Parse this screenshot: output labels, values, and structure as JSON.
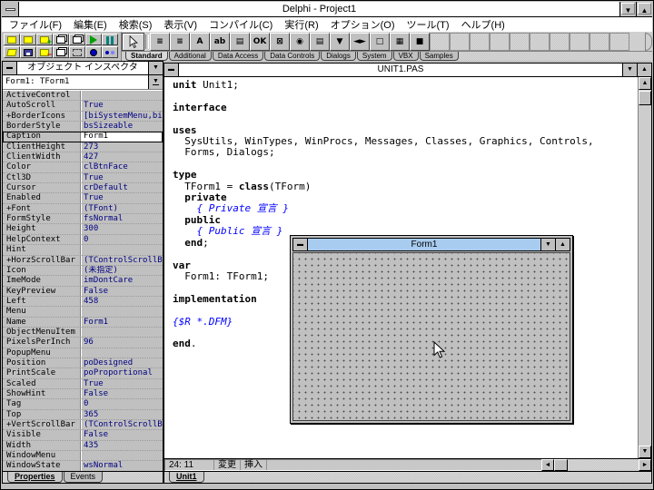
{
  "window": {
    "title": "Delphi - Project1",
    "menus": [
      "ファイル(F)",
      "編集(E)",
      "検索(S)",
      "表示(V)",
      "コンパイル(C)",
      "実行(R)",
      "オプション(O)",
      "ツール(T)",
      "ヘルプ(H)"
    ]
  },
  "toolbar": {
    "speed_buttons_row1": [
      {
        "name": "open-project-button",
        "icon": "folder",
        "badge": "",
        "badge_color": ""
      },
      {
        "name": "save-project-button",
        "icon": "folder",
        "badge": "",
        "badge_color": ""
      },
      {
        "name": "add-file-button",
        "icon": "folder",
        "badge": "+",
        "badge_color": "#00a000"
      },
      {
        "name": "view-unit-button",
        "icon": "pages",
        "badge": "",
        "badge_color": ""
      },
      {
        "name": "view-form-button",
        "icon": "pages",
        "badge": "",
        "badge_color": ""
      },
      {
        "name": "run-button",
        "icon": "run",
        "badge": "",
        "badge_color": ""
      },
      {
        "name": "pause-button",
        "icon": "pause",
        "badge": "",
        "badge_color": ""
      }
    ],
    "speed_buttons_row2": [
      {
        "name": "open-file-button",
        "icon": "folder-open",
        "badge": "",
        "badge_color": ""
      },
      {
        "name": "save-file-button",
        "icon": "floppy",
        "badge": "",
        "badge_color": ""
      },
      {
        "name": "remove-file-button",
        "icon": "folder",
        "badge": "−",
        "badge_color": "#d00000"
      },
      {
        "name": "new-form-button",
        "icon": "pages",
        "badge": "",
        "badge_color": ""
      },
      {
        "name": "toggle-form-unit-button",
        "icon": "select",
        "badge": "",
        "badge_color": ""
      },
      {
        "name": "trace-into-button",
        "icon": "debug",
        "badge": "",
        "badge_color": ""
      },
      {
        "name": "step-over-button",
        "icon": "debug2",
        "badge": "",
        "badge_color": ""
      }
    ],
    "components": [
      {
        "name": "component-mainmenu",
        "glyph": "≡"
      },
      {
        "name": "component-popupmenu",
        "glyph": "≡"
      },
      {
        "name": "component-label",
        "glyph": "A"
      },
      {
        "name": "component-edit",
        "glyph": "ab"
      },
      {
        "name": "component-memo",
        "glyph": "▤"
      },
      {
        "name": "component-button",
        "glyph": "OK"
      },
      {
        "name": "component-checkbox",
        "glyph": "⊠"
      },
      {
        "name": "component-radiobutton",
        "glyph": "◉"
      },
      {
        "name": "component-listbox",
        "glyph": "▤"
      },
      {
        "name": "component-combobox",
        "glyph": "▼"
      },
      {
        "name": "component-scrollbar",
        "glyph": "◄►"
      },
      {
        "name": "component-groupbox",
        "glyph": "□"
      },
      {
        "name": "component-radiogroup",
        "glyph": "▦"
      },
      {
        "name": "component-panel",
        "glyph": "■"
      }
    ],
    "empty_cells": 10,
    "palette_tabs": [
      "Standard",
      "Additional",
      "Data Access",
      "Data Controls",
      "Dialogs",
      "System",
      "VBX",
      "Samples"
    ]
  },
  "inspector": {
    "title": "オブジェクト インスペクタ",
    "selected_object": "Form1: TForm1",
    "tabs": [
      "Properties",
      "Events"
    ],
    "properties": [
      {
        "n": "ActiveControl",
        "v": ""
      },
      {
        "n": "AutoScroll",
        "v": "True"
      },
      {
        "n": "+BorderIcons",
        "v": "[biSystemMenu,biMi"
      },
      {
        "n": "BorderStyle",
        "v": "bsSizeable"
      },
      {
        "n": "Caption",
        "v": "Form1",
        "edit": true
      },
      {
        "n": "ClientHeight",
        "v": "273"
      },
      {
        "n": "ClientWidth",
        "v": "427"
      },
      {
        "n": "Color",
        "v": "clBtnFace"
      },
      {
        "n": "Ctl3D",
        "v": "True"
      },
      {
        "n": "Cursor",
        "v": "crDefault"
      },
      {
        "n": "Enabled",
        "v": "True"
      },
      {
        "n": "+Font",
        "v": "(TFont)"
      },
      {
        "n": "FormStyle",
        "v": "fsNormal"
      },
      {
        "n": "Height",
        "v": "300"
      },
      {
        "n": "HelpContext",
        "v": "0"
      },
      {
        "n": "Hint",
        "v": ""
      },
      {
        "n": "+HorzScrollBar",
        "v": "(TControlScrollBar"
      },
      {
        "n": "Icon",
        "v": "(未指定)"
      },
      {
        "n": "ImeMode",
        "v": "imDontCare"
      },
      {
        "n": "KeyPreview",
        "v": "False"
      },
      {
        "n": "Left",
        "v": "458"
      },
      {
        "n": "Menu",
        "v": ""
      },
      {
        "n": "Name",
        "v": "Form1"
      },
      {
        "n": "ObjectMenuItem",
        "v": ""
      },
      {
        "n": "PixelsPerInch",
        "v": "96"
      },
      {
        "n": "PopupMenu",
        "v": ""
      },
      {
        "n": "Position",
        "v": "poDesigned"
      },
      {
        "n": "PrintScale",
        "v": "poProportional"
      },
      {
        "n": "Scaled",
        "v": "True"
      },
      {
        "n": "ShowHint",
        "v": "False"
      },
      {
        "n": "Tag",
        "v": "0"
      },
      {
        "n": "Top",
        "v": "365"
      },
      {
        "n": "+VertScrollBar",
        "v": "(TControlScrollBar"
      },
      {
        "n": "Visible",
        "v": "False"
      },
      {
        "n": "Width",
        "v": "435"
      },
      {
        "n": "WindowMenu",
        "v": ""
      },
      {
        "n": "WindowState",
        "v": "wsNormal"
      }
    ]
  },
  "editor": {
    "title": "UNIT1.PAS",
    "tab": "Unit1",
    "status": {
      "line_col": " 24:  11",
      "modified": "変更",
      "mode": "挿入"
    },
    "code": [
      [
        [
          "k",
          "unit"
        ],
        [
          "p",
          " Unit1;"
        ]
      ],
      [],
      [
        [
          "k",
          "interface"
        ]
      ],
      [],
      [
        [
          "k",
          "uses"
        ]
      ],
      [
        [
          "p",
          "  SysUtils, WinTypes, WinProcs, Messages, Classes, Graphics, Controls,"
        ]
      ],
      [
        [
          "p",
          "  Forms, Dialogs;"
        ]
      ],
      [],
      [
        [
          "k",
          "type"
        ]
      ],
      [
        [
          "p",
          "  TForm1 = "
        ],
        [
          "k",
          "class"
        ],
        [
          "p",
          "(TForm)"
        ]
      ],
      [
        [
          "p",
          "  "
        ],
        [
          "k",
          "private"
        ]
      ],
      [
        [
          "c",
          "    { Private 宣言 }"
        ]
      ],
      [
        [
          "p",
          "  "
        ],
        [
          "k",
          "public"
        ]
      ],
      [
        [
          "c",
          "    { Public 宣言 }"
        ]
      ],
      [
        [
          "p",
          "  "
        ],
        [
          "k",
          "end"
        ],
        [
          "p",
          ";"
        ]
      ],
      [],
      [
        [
          "k",
          "var"
        ]
      ],
      [
        [
          "p",
          "  Form1: TForm1;"
        ]
      ],
      [],
      [
        [
          "k",
          "implementation"
        ]
      ],
      [],
      [
        [
          "c",
          "{$R *.DFM}"
        ]
      ],
      [],
      [
        [
          "k",
          "end"
        ],
        [
          "p",
          "."
        ]
      ]
    ]
  },
  "form_designer": {
    "title": "Form1"
  },
  "colors": {
    "chrome": "#c0c0c0",
    "active_titlebar": "#a8ccf0",
    "inactive_titlebar": "#ffffff",
    "property_value": "#000080",
    "comment": "#0000ff"
  }
}
